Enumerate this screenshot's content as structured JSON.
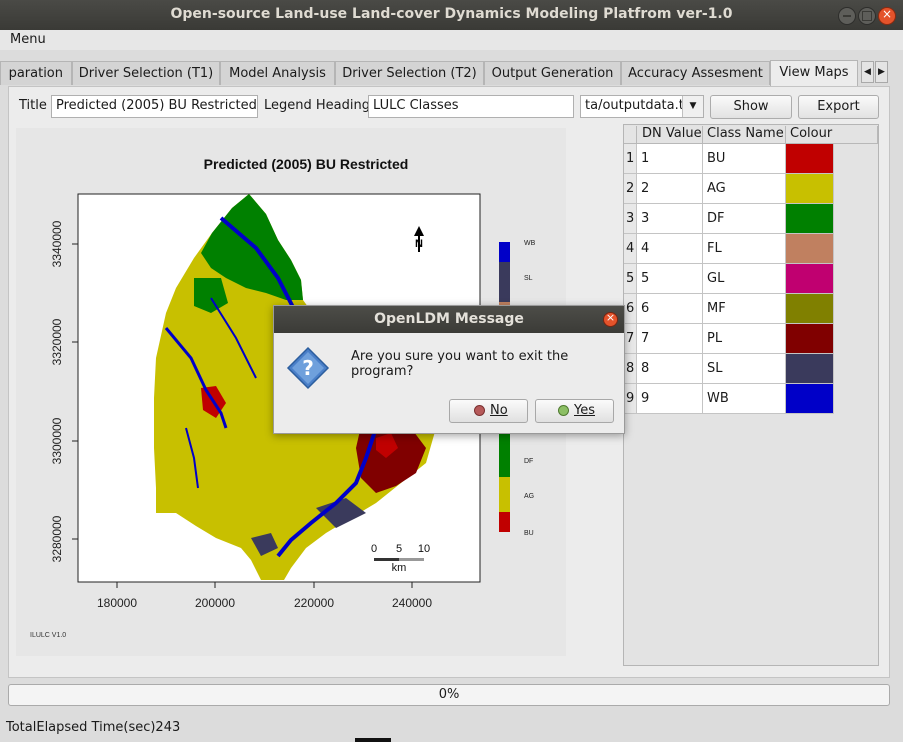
{
  "window": {
    "title": "Open-source Land-use Land-cover Dynamics Modeling Platfrom ver-1.0"
  },
  "menu": {
    "label": "Menu"
  },
  "tabs": [
    {
      "label": "paration"
    },
    {
      "label": "Driver Selection (T1)"
    },
    {
      "label": "Model Analysis"
    },
    {
      "label": "Driver Selection (T2)"
    },
    {
      "label": "Output Generation"
    },
    {
      "label": "Accuracy Assesment"
    },
    {
      "label": "View Maps"
    }
  ],
  "controls": {
    "title_label": "Title",
    "title_value": "Predicted (2005) BU Restricted",
    "legend_label": "Legend Heading",
    "legend_value": "LULC Classes",
    "file_value": "ta/outputdata.tif",
    "show_label": "Show",
    "export_label": "Export"
  },
  "map": {
    "title": "Predicted (2005) BU Restricted",
    "y_ticks": [
      "3340000",
      "3320000",
      "3300000",
      "3280000"
    ],
    "x_ticks": [
      "180000",
      "200000",
      "220000",
      "240000"
    ],
    "legend": [
      "WB",
      "SL",
      "DF",
      "AG",
      "BU"
    ],
    "scale_ticks": [
      "0",
      "5",
      "10"
    ],
    "scale_unit": "km",
    "north": "N",
    "credit": "ILULC V1.0"
  },
  "class_table": {
    "headers": [
      "DN Value",
      "Class Name",
      "Colour"
    ],
    "rows": [
      {
        "num": "1",
        "dn": "1",
        "name": "BU",
        "color": "#c00000"
      },
      {
        "num": "2",
        "dn": "2",
        "name": "AG",
        "color": "#c8c000"
      },
      {
        "num": "3",
        "dn": "3",
        "name": "DF",
        "color": "#008000"
      },
      {
        "num": "4",
        "dn": "4",
        "name": "FL",
        "color": "#c08060"
      },
      {
        "num": "5",
        "dn": "5",
        "name": "GL",
        "color": "#c00070"
      },
      {
        "num": "6",
        "dn": "6",
        "name": "MF",
        "color": "#808000"
      },
      {
        "num": "7",
        "dn": "7",
        "name": "PL",
        "color": "#800000"
      },
      {
        "num": "8",
        "dn": "8",
        "name": "SL",
        "color": "#3a3a5c"
      },
      {
        "num": "9",
        "dn": "9",
        "name": "WB",
        "color": "#0000c8"
      }
    ]
  },
  "progress": {
    "text": "0%",
    "value": 0
  },
  "status": {
    "text": "TotalElapsed Time(sec)243"
  },
  "dialog": {
    "title": "OpenLDM Message",
    "message": "Are you sure you want to exit the program?",
    "no_label": "No",
    "yes_label": "Yes"
  }
}
